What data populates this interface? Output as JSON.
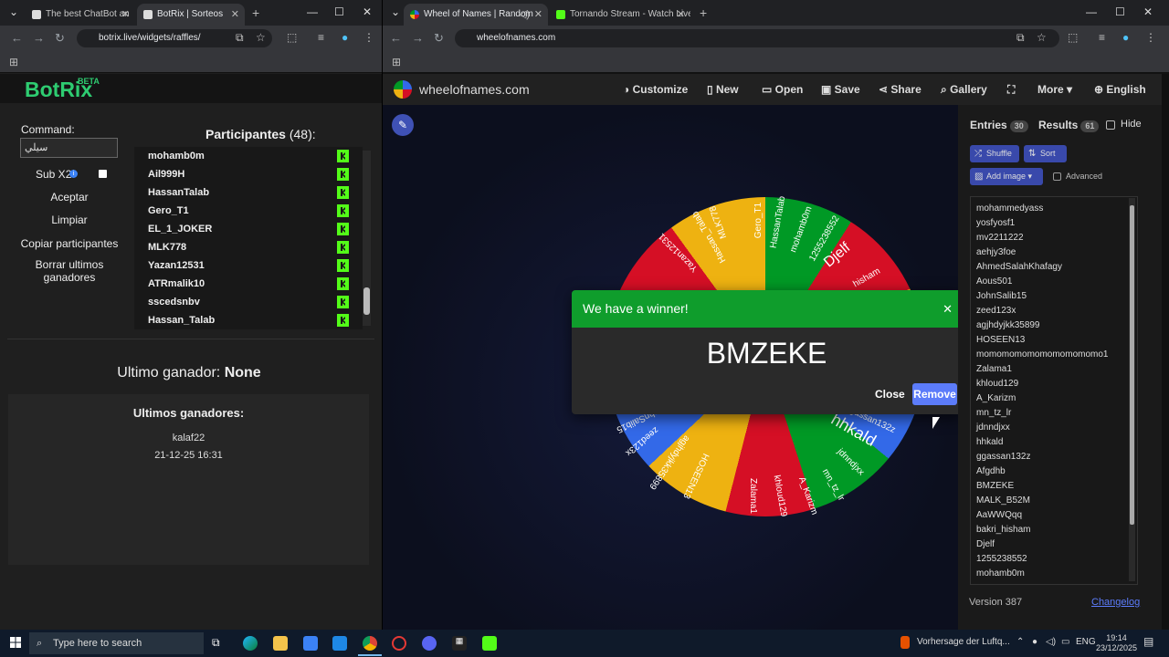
{
  "browser_left": {
    "tabs": [
      {
        "title": "The best ChatBot an",
        "active": false
      },
      {
        "title": "BotRix | Sorteos",
        "active": true
      }
    ],
    "url": "botrix.live/widgets/raffles/"
  },
  "browser_right": {
    "tabs": [
      {
        "title": "Wheel of Names | Random",
        "active": true
      },
      {
        "title": "Tornando Stream - Watch Live",
        "active": false
      }
    ],
    "url": "wheelofnames.com"
  },
  "botrix": {
    "logo": "BotRix",
    "beta": "BETA",
    "command_label": "Command:",
    "command_value": "سيلي",
    "sub_label": "Sub X2",
    "buttons": [
      "Aceptar",
      "Limpiar",
      "Copiar participantes",
      "Borrar ultimos ganadores"
    ],
    "participants_label": "Participantes",
    "participants_count": "(48):",
    "participants": [
      "mohamb0m",
      "Ail999H",
      "HassanTalab",
      "Gero_T1",
      "EL_1_JOKER",
      "MLK778",
      "Yazan12531",
      "ATRmalik10",
      "sscedsnbv",
      "Hassan_Talab"
    ],
    "last_winner_label": "Ultimo ganador:",
    "last_winner_value": "None",
    "last_winners_title": "Ultimos ganadores:",
    "last_winners": [
      {
        "name": "kalaf22",
        "date": "21-12-25 16:31"
      }
    ]
  },
  "won": {
    "site": "wheelofnames.com",
    "menu": [
      "Customize",
      "New",
      "Open",
      "Save",
      "Share",
      "Gallery",
      "More",
      "English"
    ],
    "tab_entries": "Entries",
    "entries_count": "30",
    "tab_results": "Results",
    "results_count": "61",
    "hide_label": "Hide",
    "shuffle": "Shuffle",
    "sort": "Sort",
    "add_image": "Add image",
    "advanced": "Advanced",
    "entries": [
      "mohammedyass",
      "yosfyosf1",
      "mv2211222",
      "aehjy3foe",
      "AhmedSalahKhafagy",
      "Aous501",
      "JohnSalib15",
      "zeed123x",
      "agjhdyjkk35899",
      "HOSEEN13",
      "momomomomomomomomomo1",
      "Zalama1",
      "khloud129",
      "A_Karizm",
      "mn_tz_lr",
      "jdnndjxx",
      "hhkald",
      "ggassan132z",
      "Afgdhb",
      "BMZEKE",
      "MALK_B52M",
      "AaWWQqq",
      "bakri_hisham",
      "Djelf",
      "1255238552",
      "mohamb0m"
    ],
    "version": "Version 387",
    "changelog": "Changelog",
    "wheel_labels": [
      "Gero_T1",
      "HassanTalab",
      "mohamb0m",
      "1255238552",
      "Djelf",
      "hisham",
      "MLK778",
      "Hassan_Talab",
      "Yazan12531",
      "hhkald",
      "ggassan132z",
      "jdnndjxx",
      "mn_tz_lr",
      "A_Karizm",
      "khloud129",
      "Zalama1",
      "HOSEEN13",
      "agjhdyjkk35899",
      "zeed123x",
      "JohnSalib15"
    ],
    "dialog": {
      "title": "We have a winner!",
      "winner": "BMZEKE",
      "close": "Close",
      "remove": "Remove"
    }
  },
  "taskbar": {
    "search_placeholder": "Type here to search",
    "weather": "Vorhersage der Luftq...",
    "lang": "ENG",
    "time": "19:14",
    "date": "23/12/2025"
  },
  "colors": {
    "botrix_green": "#2ecc71",
    "winner_green": "#0f9d2c",
    "remove_blue": "#5c7cfa",
    "wheel": [
      "#009925",
      "#d50f25",
      "#eeb211",
      "#3369e8"
    ]
  }
}
